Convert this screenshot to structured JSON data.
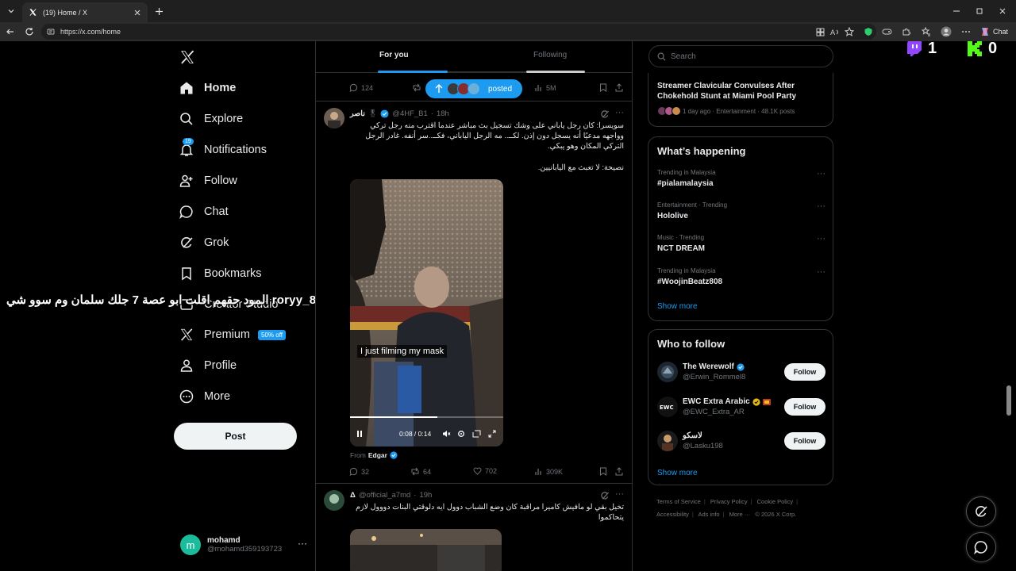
{
  "browser": {
    "tab_title": "(19) Home / X",
    "url": "https://x.com/home",
    "chat_label": "Chat"
  },
  "stream_overlay": {
    "twitch_count": "1",
    "kick_count": "0"
  },
  "overlay_text": "المود حقهم اقلت ابو عصة 7 جلك سلمان وم سوو شي  roryy_8",
  "sidebar": {
    "items": [
      {
        "label": "Home",
        "icon": "home-icon"
      },
      {
        "label": "Explore",
        "icon": "search-icon"
      },
      {
        "label": "Notifications",
        "icon": "bell-icon",
        "badge": "19"
      },
      {
        "label": "Follow",
        "icon": "person-add-icon"
      },
      {
        "label": "Chat",
        "icon": "chat-icon"
      },
      {
        "label": "Grok",
        "icon": "grok-icon"
      },
      {
        "label": "Bookmarks",
        "icon": "bookmark-icon"
      },
      {
        "label": "Creator Studio",
        "icon": "creator-icon"
      },
      {
        "label": "Premium",
        "icon": "x-icon",
        "badge": "50% off"
      },
      {
        "label": "Profile",
        "icon": "profile-icon"
      },
      {
        "label": "More",
        "icon": "more-circle-icon"
      }
    ],
    "post_label": "Post",
    "account": {
      "initial": "m",
      "name": "mohamd",
      "handle": "@mohamd359193723"
    }
  },
  "timeline": {
    "tabs": [
      "For you",
      "Following"
    ],
    "posted_label": "posted",
    "prev_actions": {
      "replies": "124",
      "views": "5M"
    },
    "tweet1": {
      "name": "ناصر",
      "handle": "@4HF_B1",
      "time": "18h",
      "text": "سويسرا: كان رجل ياباني على وشك تسجيل بث مباشر عندما اقترب منه رجل تركي وواجهه مدعيًا أنه يسجل دون إذن. لكــ.. مه الرجل الياباني، فكــ..سر أنفه. غادر الرجل التركي المكان وهو يبكي.",
      "advice": "نصيحة: لا تعبث مع اليابانيين.",
      "video_caption": "I just filming my mask",
      "video_time": "0:08 / 0:14",
      "video_progress": 0.57,
      "from_label": "From",
      "from_name": "Edgar",
      "replies": "32",
      "reposts": "64",
      "likes": "702",
      "views": "309K"
    },
    "tweet2": {
      "name": "Δ",
      "handle": "@official_a7md",
      "time": "19h",
      "text": "تخيل بقي لو مافيش كاميرا مراقبة كان وضع الشباب دوول ايه دلوقتي البنات دووول لازم يتحاكموا"
    }
  },
  "right": {
    "search_placeholder": "Search",
    "news": {
      "title": "Streamer Clavicular Convulses After Chokehold Stunt at Miami Pool Party",
      "meta": "1 day ago · Entertainment · 48.1K posts"
    },
    "happening_title": "What’s happening",
    "trends": [
      {
        "context": "Trending in Malaysia",
        "name": "#pialamalaysia"
      },
      {
        "context": "Entertainment · Trending",
        "name": "Hololive"
      },
      {
        "context": "Music · Trending",
        "name": "NCT DREAM"
      },
      {
        "context": "Trending in Malaysia",
        "name": "#WoojinBeatz808"
      }
    ],
    "show_more": "Show more",
    "wtf_title": "Who to follow",
    "who_to_follow": [
      {
        "name": "The Werewolf",
        "handle": "@Erwin_Rommel8",
        "button": "Follow"
      },
      {
        "name": "EWC Extra Arabic",
        "handle": "@EWC_Extra_AR",
        "button": "Follow"
      },
      {
        "name": "لاسكو",
        "handle": "@Lasku198",
        "button": "Follow"
      }
    ],
    "footer": [
      "Terms of Service",
      "Privacy Policy",
      "Cookie Policy",
      "Accessibility",
      "Ads info",
      "More ···",
      "© 2026 X Corp."
    ]
  },
  "colors": {
    "accent": "#1d9bf0",
    "background": "#000000",
    "border": "#2f3336",
    "muted": "#71767b"
  }
}
